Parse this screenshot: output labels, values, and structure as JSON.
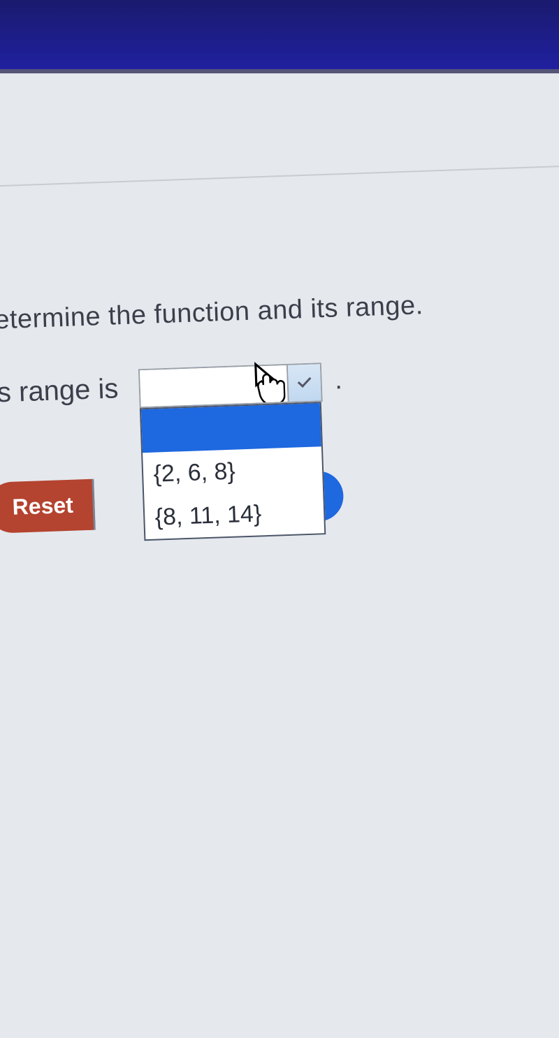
{
  "question": {
    "instruction": "etermine the function and its range.",
    "prompt_prefix": "s range is",
    "period": "."
  },
  "dropdown": {
    "selected": "",
    "options": [
      "",
      "{2, 6, 8}",
      "{8, 11, 14}"
    ]
  },
  "buttons": {
    "reset": "Reset"
  }
}
